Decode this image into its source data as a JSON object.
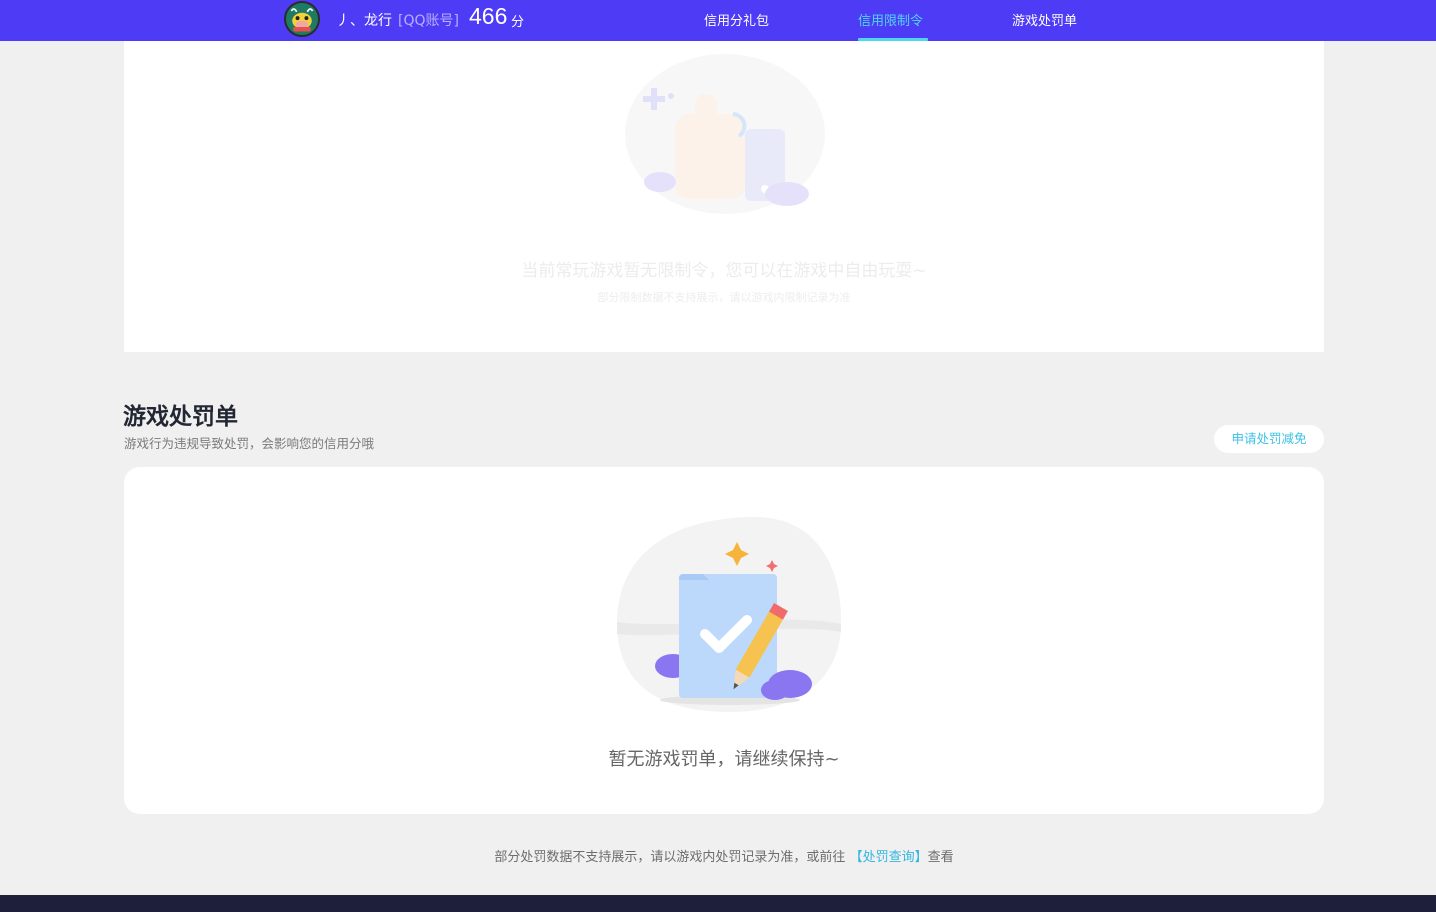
{
  "header": {
    "user_name": "丿、龙行",
    "account_type": "[QQ账号]",
    "score": "466",
    "score_unit": "分",
    "tabs": [
      {
        "label": "信用分礼包",
        "active": false
      },
      {
        "label": "信用限制令",
        "active": true
      },
      {
        "label": "游戏处罚单",
        "active": false
      }
    ],
    "accent_color": "#4e3bf5",
    "active_tab_color": "#4fd7f2"
  },
  "restriction": {
    "empty_message": "当前常玩游戏暂无限制令，您可以在游戏中自由玩耍~",
    "note": "部分限制数据不支持展示，请以游戏内限制记录为准"
  },
  "penalty": {
    "title": "游戏处罚单",
    "subtitle": "游戏行为违规导致处罚，会影响您的信用分哦",
    "appeal_button": "申请处罚减免",
    "empty_message": "暂无游戏罚单，请继续保持~",
    "footnote_prefix": "部分处罚数据不支持展示，请以游戏内处罚记录为准，或前往",
    "footnote_link": "【处罚查询】",
    "footnote_suffix": "查看"
  },
  "icons": {
    "avatar": "cartoon-cow-avatar",
    "restriction_illustration": "thumbs-up-phone-illustration",
    "penalty_illustration": "folder-check-pencil-illustration"
  }
}
